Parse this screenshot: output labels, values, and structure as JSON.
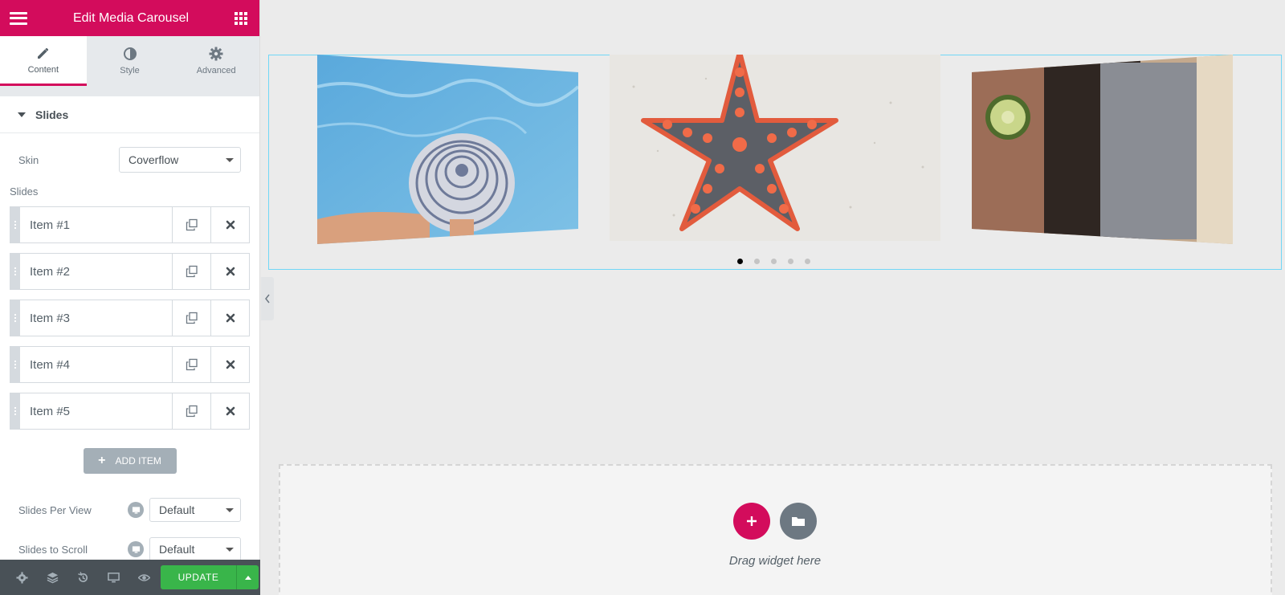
{
  "panel": {
    "title": "Edit Media Carousel",
    "tabs": [
      {
        "label": "Content",
        "icon": "pencil-icon",
        "active": true
      },
      {
        "label": "Style",
        "icon": "contrast-icon",
        "active": false
      },
      {
        "label": "Advanced",
        "icon": "gear-icon",
        "active": false
      }
    ],
    "section_title": "Slides",
    "skin": {
      "label": "Skin",
      "value": "Coverflow"
    },
    "slides_label": "Slides",
    "slides": [
      {
        "title": "Item #1"
      },
      {
        "title": "Item #2"
      },
      {
        "title": "Item #3"
      },
      {
        "title": "Item #4"
      },
      {
        "title": "Item #5"
      }
    ],
    "add_item_label": "ADD ITEM",
    "slides_per_view": {
      "label": "Slides Per View",
      "value": "Default"
    },
    "slides_to_scroll": {
      "label": "Slides to Scroll",
      "value": "Default"
    }
  },
  "footer": {
    "icons": [
      "settings-icon",
      "navigator-icon",
      "history-icon",
      "responsive-icon",
      "preview-icon"
    ],
    "update_label": "UPDATE"
  },
  "canvas": {
    "carousel": {
      "pagination_total": 5,
      "pagination_active": 1
    },
    "drop_text": "Drag widget here"
  },
  "colors": {
    "brand": "#d30c5c",
    "update": "#39b54a",
    "selection_border": "#71d7f7"
  }
}
